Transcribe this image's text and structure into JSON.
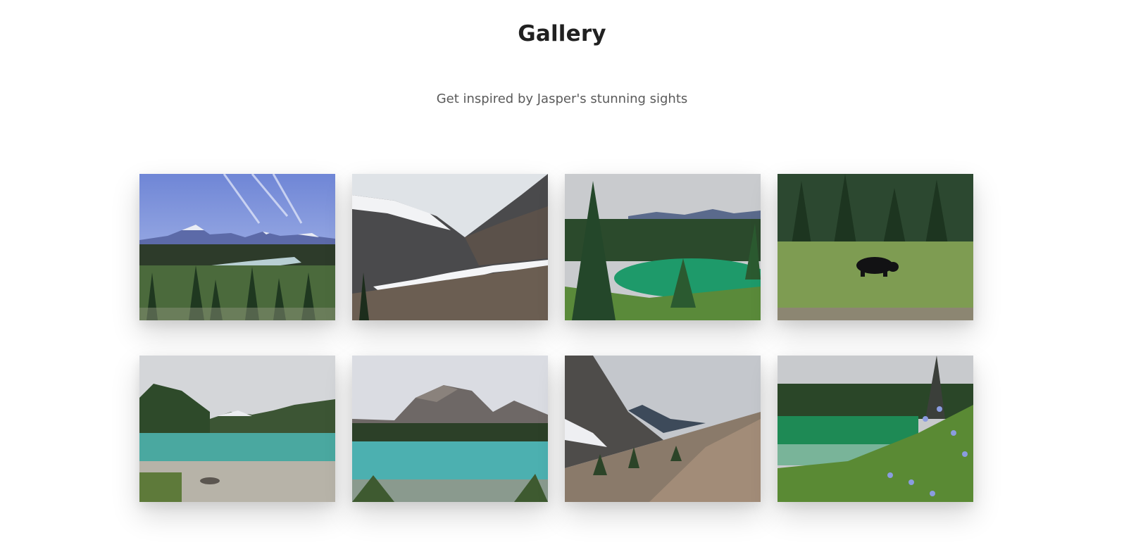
{
  "header": {
    "title": "Gallery",
    "subtitle": "Get inspired by Jasper's stunning sights"
  },
  "gallery": {
    "photos": [
      {
        "subject": "mountain-valley-river"
      },
      {
        "subject": "glacier-cliff"
      },
      {
        "subject": "emerald-lake-forest"
      },
      {
        "subject": "black-bear-meadow"
      },
      {
        "subject": "turquoise-lake-reflection"
      },
      {
        "subject": "mountain-lake"
      },
      {
        "subject": "rocky-valley-glacier"
      },
      {
        "subject": "green-lake-wildflowers"
      }
    ]
  }
}
